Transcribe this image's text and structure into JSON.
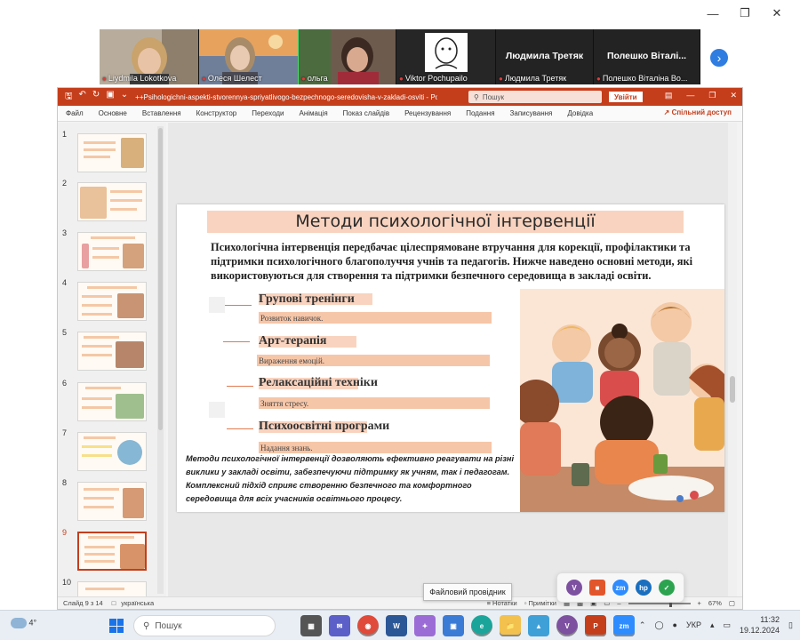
{
  "gallery": {
    "participants": [
      {
        "name": "Liydmila Lokotkova"
      },
      {
        "name": "Олеся Шелест"
      },
      {
        "name": "ольга"
      },
      {
        "name": ""
      },
      {
        "name": "Viktor Pochupailo"
      },
      {
        "display": "Людмила Третяк",
        "name": "Людмила Третяк"
      },
      {
        "display": "Полешко  Віталі...",
        "name": "Полешко Віталіна Во..."
      }
    ]
  },
  "ppt": {
    "filename": "++Psihologichni-aspekti-stvorennya-spriyatlivogo-bezpechnogo-seredovisha-v-zakladi-osviti  -  PowerPoint",
    "search_placeholder": "Пошук",
    "signin": "Увійти",
    "ribbon_tabs": [
      "Файл",
      "Основне",
      "Вставлення",
      "Конструктор",
      "Переходи",
      "Анімація",
      "Показ слайдів",
      "Рецензування",
      "Подання",
      "Записування",
      "Довідка"
    ],
    "share": "Спільний доступ",
    "slide_numbers": [
      "1",
      "2",
      "3",
      "4",
      "5",
      "6",
      "7",
      "8",
      "9",
      "10"
    ],
    "status_slide": "Слайд 9 з 14",
    "status_lang": "українська",
    "status_notes": "Нотатки",
    "status_comments": "Примітки",
    "zoom": "67%"
  },
  "slide": {
    "title": "Методи психологічної інтервенції",
    "intro": "Психологічна інтервенція передбачає цілеспрямоване втручання для корекції, профілактики та підтримки психологічного благополуччя учнів та педагогів. Нижче наведено основні методи, які використовуються для створення та підтримки безпечного середовища в закладі освіти.",
    "methods": [
      {
        "name": "Групові тренінги",
        "desc": "Розвиток навичок."
      },
      {
        "name": "Арт-терапія",
        "desc": "Вираження емоцій."
      },
      {
        "name": "Релаксаційні техніки",
        "desc": "Зняття стресу."
      },
      {
        "name": "Психоосвітні програми",
        "desc": "Надання знань."
      }
    ],
    "footer": "Методи психологічної інтервенції дозволяють ефективно реагувати на різні виклики у закладі освіти, забезпечуючи підтримку як учням, так і педагогам. Комплексний підхід сприяє створенню безпечного та комфортного середовища для всіх учасників освітнього процесу."
  },
  "tooltip": "Файловий провідник",
  "taskbar": {
    "weather": "4°",
    "search": "Пошук",
    "lang": "УКР",
    "time": "11:32",
    "date": "19.12.2024"
  }
}
